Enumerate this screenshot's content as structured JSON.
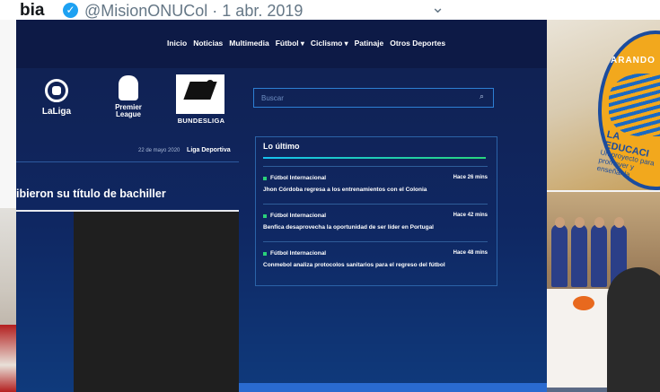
{
  "tweet": {
    "name": "bia",
    "handle_date": "@MisionONUCol · 1 abr. 2019"
  },
  "site": {
    "nav": [
      "Inicio",
      "Noticias",
      "Multimedia",
      "Fútbol",
      "Ciclismo",
      "Patinaje",
      "Otros Deportes"
    ],
    "leagues": {
      "laliga": "LaLiga",
      "premier_line1": "Premier",
      "premier_line2": "League",
      "bundesliga": "BUNDESLIGA"
    },
    "search_placeholder": "Buscar",
    "date": "22 de mayo 2020",
    "source": "Liga Deportiva",
    "headline": "ibieron su título de bachiller",
    "latest": {
      "title": "Lo último",
      "items": [
        {
          "category": "Fútbol Internacional",
          "time": "Hace 26 mins",
          "title": "Jhon Córdoba regresa a los entrenamientos con el Colonia"
        },
        {
          "category": "Fútbol Internacional",
          "time": "Hace 42 mins",
          "title": "Benfica desaprovecha la oportunidad de ser líder en Portugal"
        },
        {
          "category": "Fútbol Internacional",
          "time": "Hace 48 mins",
          "title": "Conmebol analiza protocolos sanitarios para el regreso del fútbol"
        }
      ]
    }
  },
  "photo": {
    "banner_top": "ARANDO",
    "banner_mid": "LA EDUCACI",
    "banner_low": "Un proyecto para\npromover y enseñar la"
  },
  "colors": {
    "site_bg": "#11204f",
    "accent_green": "#2ad27a",
    "accent_blue": "#2d7fd4"
  }
}
